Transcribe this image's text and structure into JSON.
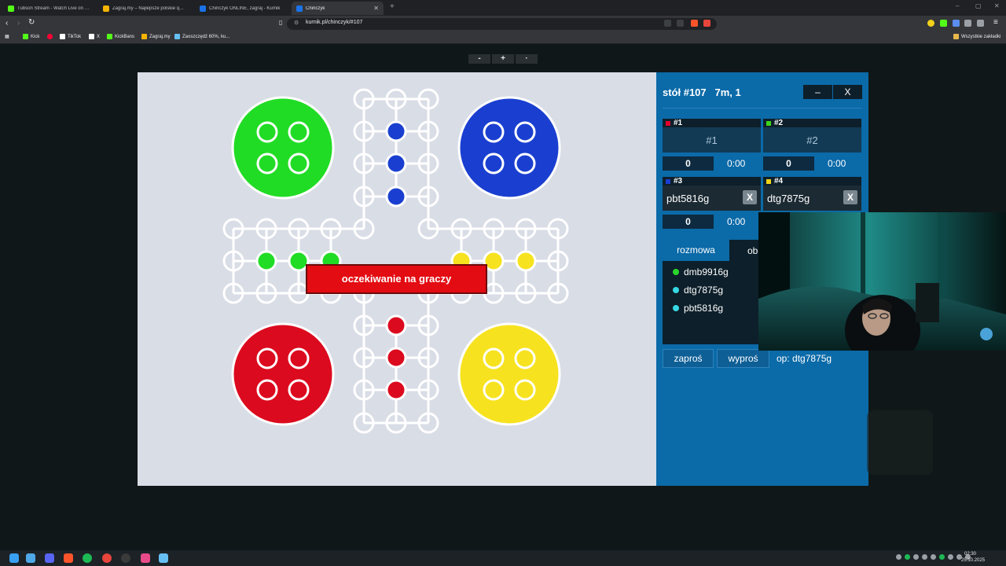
{
  "browser": {
    "tabs": [
      {
        "title": "Tubson Stream - Watch Live on Kick",
        "favicon_color": "#53fc18"
      },
      {
        "title": "Zagraj.my – Najlepsze polskie quizy",
        "favicon_color": "#f4b400"
      },
      {
        "title": "Chińczyk ONLINE, zagraj - Kurnik",
        "favicon_color": "#1a73e8"
      },
      {
        "title": "Chińczyk",
        "favicon_color": "#1a73e8"
      }
    ],
    "new_tab": "+",
    "window_controls": [
      "–",
      "▢",
      "✕"
    ],
    "url": "kurnik.pl/chinczyk/#107",
    "bookmarks": [
      {
        "label": "Kick",
        "icon_color": "#53fc18"
      },
      {
        "label": "",
        "icon_color": "#ff0033"
      },
      {
        "label": "TikTok",
        "icon_color": "#ffffff"
      },
      {
        "label": "X",
        "icon_color": "#ffffff"
      },
      {
        "label": "KickBans",
        "icon_color": "#53fc18"
      },
      {
        "label": "Zagraj.my",
        "icon_color": "#f4b400"
      },
      {
        "label": "Zaoszczędź 60%, ku...",
        "icon_color": "#66c0f4"
      }
    ],
    "bookmarks_folder": "Wszystkie zakładki"
  },
  "zoom": {
    "minus": "-",
    "plus": "+",
    "reset": "·"
  },
  "board": {
    "status_banner": "oczekiwanie na graczy",
    "colors": {
      "green": "#21dc25",
      "blue": "#1a3fd0",
      "red": "#dc0a1e",
      "yellow": "#f7e21f",
      "bg": "#d9dde6"
    }
  },
  "panel": {
    "title": "stół #107   7m, 1",
    "minimize_label": "–",
    "close_label": "X",
    "slots": [
      {
        "header": "#1",
        "color": "#e4002b",
        "name": "#1",
        "score": "0",
        "time": "0:00",
        "kick": ""
      },
      {
        "header": "#2",
        "color": "#3cd61b",
        "name": "#2",
        "score": "0",
        "time": "0:00",
        "kick": ""
      },
      {
        "header": "#3",
        "color": "#1a3fd0",
        "name": "pbt5816g",
        "score": "0",
        "time": "0:00",
        "kick": "X"
      },
      {
        "header": "#4",
        "color": "#f3d21a",
        "name": "dtg7875g",
        "score": "",
        "time": "",
        "kick": "X"
      }
    ],
    "tabs": {
      "chat": "rozmowa",
      "observers": "ob"
    },
    "users": [
      {
        "name": "dmb9916g",
        "color": "#2bd62b"
      },
      {
        "name": "dtg7875g",
        "color": "#36d8e3"
      },
      {
        "name": "pbt5816g",
        "color": "#36d8e3"
      }
    ],
    "invite_label": "zaproś",
    "kick_label": "wyproś",
    "op_label": "op: dtg7875g"
  },
  "taskbar": {
    "time": "02:30",
    "date": "25.10.2025",
    "apps": [
      {
        "name": "windows",
        "color": "#3aa0f3"
      },
      {
        "name": "explorer",
        "color": "#4fa8e8"
      },
      {
        "name": "discord",
        "color": "#5865f2"
      },
      {
        "name": "brave",
        "color": "#fb542b"
      },
      {
        "name": "spotify",
        "color": "#1db954"
      },
      {
        "name": "chrome",
        "color": "#e8453c"
      },
      {
        "name": "obs",
        "color": "#3a3a3a"
      },
      {
        "name": "app-pink",
        "color": "#e84a8a"
      },
      {
        "name": "steam",
        "color": "#66c0f4"
      }
    ]
  }
}
